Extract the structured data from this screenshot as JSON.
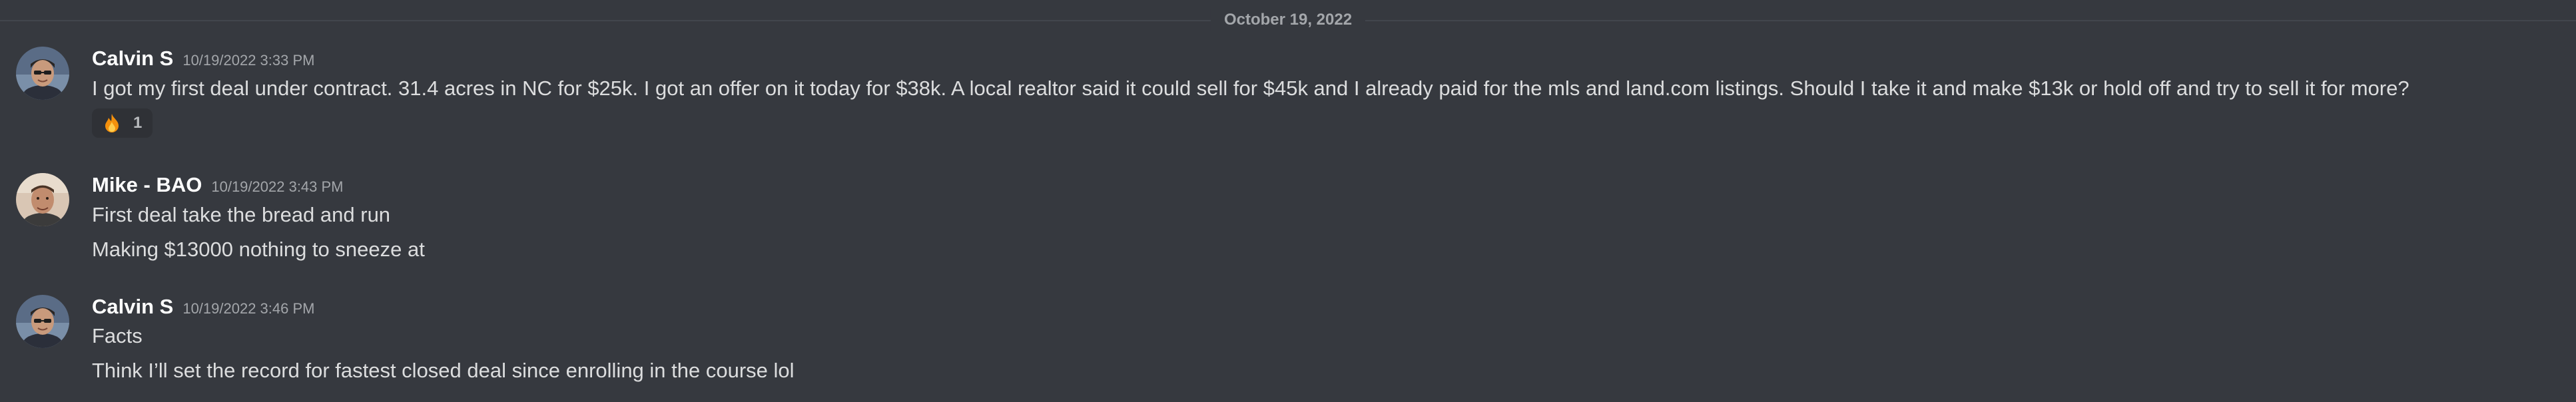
{
  "date_divider": "October 19, 2022",
  "messages": [
    {
      "author": "Calvin S",
      "timestamp": "10/19/2022 3:33 PM",
      "lines": [
        "I got my first deal under contract. 31.4 acres in NC for $25k. I got an offer on it today for $38k. A local realtor said it could sell for $45k and I already paid for the mls and land.com listings. Should I take it and make $13k or hold off and try to sell it for more?"
      ],
      "reaction": {
        "emoji": "fire-emoji",
        "count": "1"
      }
    },
    {
      "author": "Mike - BAO",
      "timestamp": "10/19/2022 3:43 PM",
      "lines": [
        "First deal take the bread and run",
        "Making $13000 nothing to sneeze at"
      ]
    },
    {
      "author": "Calvin S",
      "timestamp": "10/19/2022 3:46 PM",
      "lines": [
        "Facts",
        "Think I’ll set the record for fastest closed deal since enrolling in the course lol"
      ]
    }
  ],
  "colors": {
    "background": "#36393f",
    "text": "#dcddde",
    "author": "#ffffff",
    "muted": "#a3a6aa",
    "reaction_bg": "#2f3136"
  }
}
